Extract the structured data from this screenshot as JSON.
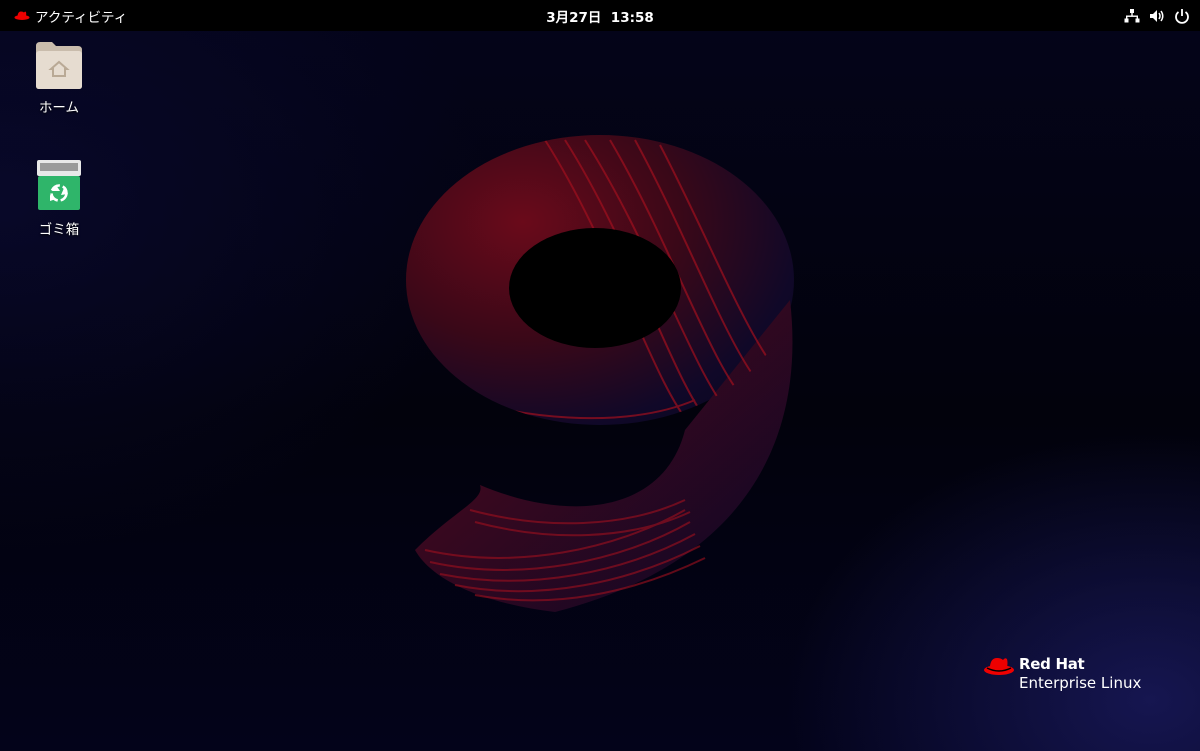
{
  "topbar": {
    "activities_label": "アクティビティ",
    "clock": "3月27日  13:58",
    "tray_icons": [
      "network-wired-icon",
      "volume-icon",
      "power-icon"
    ]
  },
  "desktop_icons": [
    {
      "label": "ホーム",
      "icon": "home-folder-icon"
    },
    {
      "label": "ゴミ箱",
      "icon": "trash-icon"
    }
  ],
  "wallpaper": {
    "branding_line1": "Red Hat",
    "branding_line2": "Enterprise Linux",
    "accent_color": "#ee0000"
  }
}
